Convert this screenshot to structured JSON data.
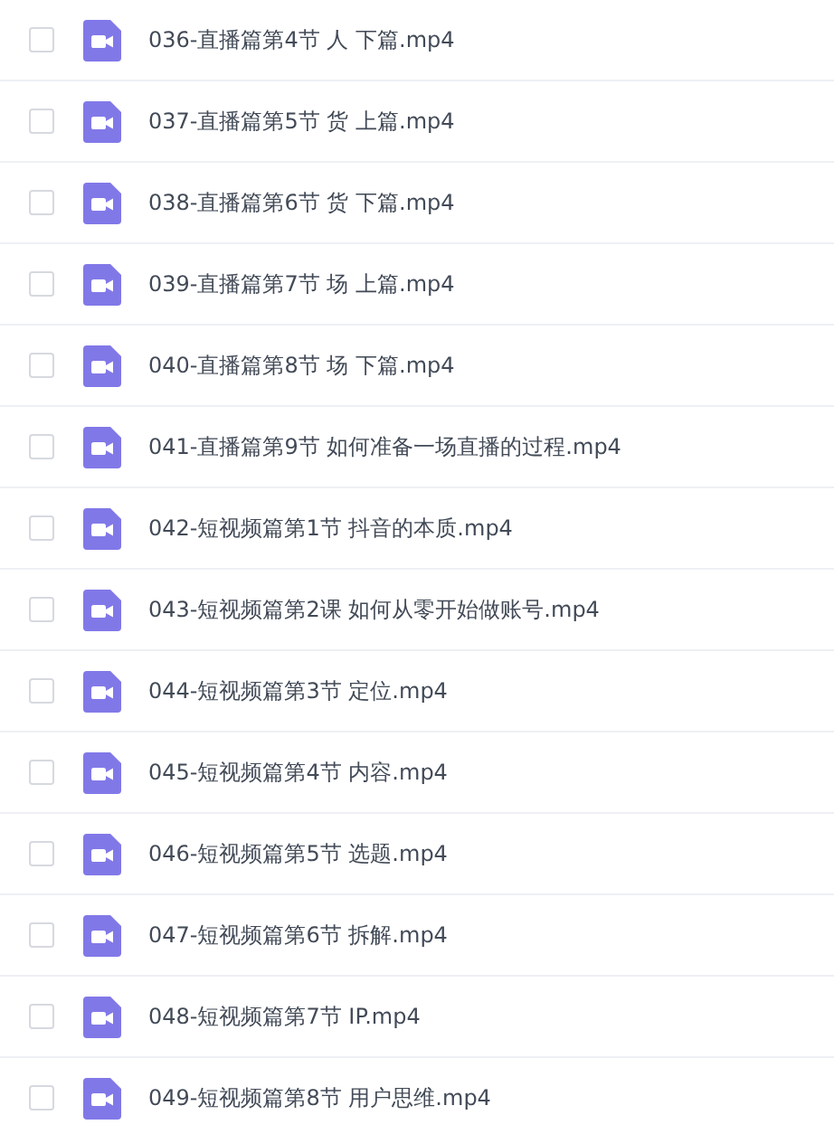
{
  "files": [
    {
      "name": "036-直播篇第4节 人 下篇.mp4",
      "checked": false
    },
    {
      "name": "037-直播篇第5节 货 上篇.mp4",
      "checked": false
    },
    {
      "name": "038-直播篇第6节 货 下篇.mp4",
      "checked": false
    },
    {
      "name": "039-直播篇第7节 场 上篇.mp4",
      "checked": false
    },
    {
      "name": "040-直播篇第8节 场 下篇.mp4",
      "checked": false
    },
    {
      "name": "041-直播篇第9节 如何准备一场直播的过程.mp4",
      "checked": false
    },
    {
      "name": "042-短视频篇第1节 抖音的本质.mp4",
      "checked": false
    },
    {
      "name": "043-短视频篇第2课 如何从零开始做账号.mp4",
      "checked": false
    },
    {
      "name": "044-短视频篇第3节 定位.mp4",
      "checked": false
    },
    {
      "name": "045-短视频篇第4节 内容.mp4",
      "checked": false
    },
    {
      "name": "046-短视频篇第5节 选题.mp4",
      "checked": false
    },
    {
      "name": "047-短视频篇第6节 拆解.mp4",
      "checked": false
    },
    {
      "name": "048-短视频篇第7节 IP.mp4",
      "checked": false
    },
    {
      "name": "049-短视频篇第8节 用户思维.mp4",
      "checked": false
    }
  ]
}
